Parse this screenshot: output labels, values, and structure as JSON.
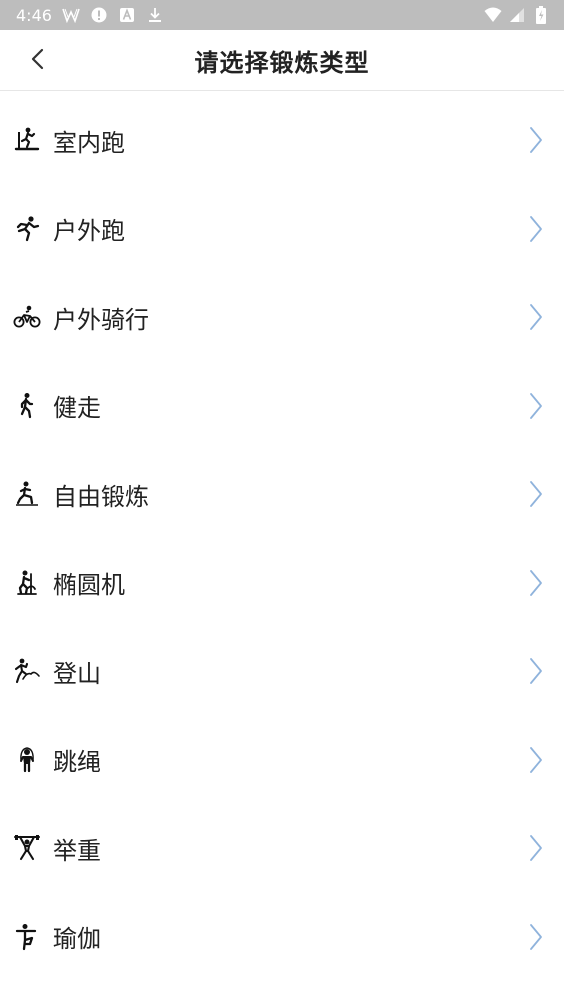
{
  "status_bar": {
    "time": "4:46",
    "icons": [
      "w-app-icon",
      "alert-icon",
      "a-app-icon",
      "download-icon",
      "wifi-icon",
      "signal-icon",
      "battery-icon"
    ]
  },
  "header": {
    "title": "请选择锻炼类型",
    "back_icon": "chevron-left-icon"
  },
  "colors": {
    "status_bar_bg": "#bdbdbd",
    "chevron": "#8fb3dc",
    "text": "#222222"
  },
  "workouts": [
    {
      "label": "室内跑",
      "icon": "treadmill-icon"
    },
    {
      "label": "户外跑",
      "icon": "runner-icon"
    },
    {
      "label": "户外骑行",
      "icon": "cyclist-icon"
    },
    {
      "label": "健走",
      "icon": "walker-icon"
    },
    {
      "label": "自由锻炼",
      "icon": "free-training-icon"
    },
    {
      "label": "椭圆机",
      "icon": "elliptical-icon"
    },
    {
      "label": "登山",
      "icon": "climbing-icon"
    },
    {
      "label": "跳绳",
      "icon": "jump-rope-icon"
    },
    {
      "label": "举重",
      "icon": "weightlifting-icon"
    },
    {
      "label": "瑜伽",
      "icon": "yoga-icon"
    }
  ]
}
